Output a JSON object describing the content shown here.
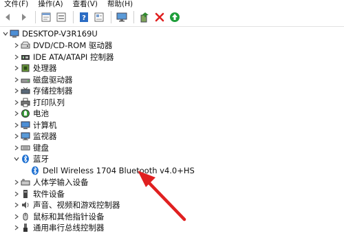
{
  "menu": {
    "file": "文件(F)",
    "action": "操作(A)",
    "view": "查看(V)",
    "help": "帮助(H)"
  },
  "toolbar": {
    "icons": [
      "back-icon",
      "forward-icon",
      "properties-icon",
      "show-hidden-icon",
      "help-icon",
      "action-icon",
      "monitor-icon",
      "update-driver-icon",
      "uninstall-icon",
      "enable-device-icon"
    ]
  },
  "tree": {
    "root": "DESKTOP-V3R169U",
    "categories": [
      {
        "label": "DVD/CD-ROM 驱动器",
        "icon": "dvd-drive-icon",
        "expanded": false
      },
      {
        "label": "IDE ATA/ATAPI 控制器",
        "icon": "ide-controller-icon",
        "expanded": false
      },
      {
        "label": "处理器",
        "icon": "processor-icon",
        "expanded": false
      },
      {
        "label": "磁盘驱动器",
        "icon": "disk-drive-icon",
        "expanded": false
      },
      {
        "label": "存储控制器",
        "icon": "storage-controller-icon",
        "expanded": false
      },
      {
        "label": "打印队列",
        "icon": "printer-icon",
        "expanded": false
      },
      {
        "label": "电池",
        "icon": "battery-icon",
        "expanded": false
      },
      {
        "label": "计算机",
        "icon": "computer-icon",
        "expanded": false
      },
      {
        "label": "监视器",
        "icon": "monitor-icon",
        "expanded": false
      },
      {
        "label": "键盘",
        "icon": "keyboard-icon",
        "expanded": false
      },
      {
        "label": "蓝牙",
        "icon": "bluetooth-icon",
        "expanded": true
      },
      {
        "label": "人体学输入设备",
        "icon": "hid-icon",
        "expanded": false
      },
      {
        "label": "软件设备",
        "icon": "software-device-icon",
        "expanded": false
      },
      {
        "label": "声音、视频和游戏控制器",
        "icon": "audio-icon",
        "expanded": false
      },
      {
        "label": "鼠标和其他指针设备",
        "icon": "mouse-icon",
        "expanded": false
      },
      {
        "label": "通用串行总线控制器",
        "icon": "usb-icon",
        "expanded": false
      }
    ],
    "bluetooth_child": "Dell Wireless 1704 Bluetooth v4.0+HS"
  },
  "colors": {
    "arrow": "#e02020",
    "uninstall": "#e02020",
    "enable": "#1e9e3a",
    "help": "#2a6cc4"
  }
}
